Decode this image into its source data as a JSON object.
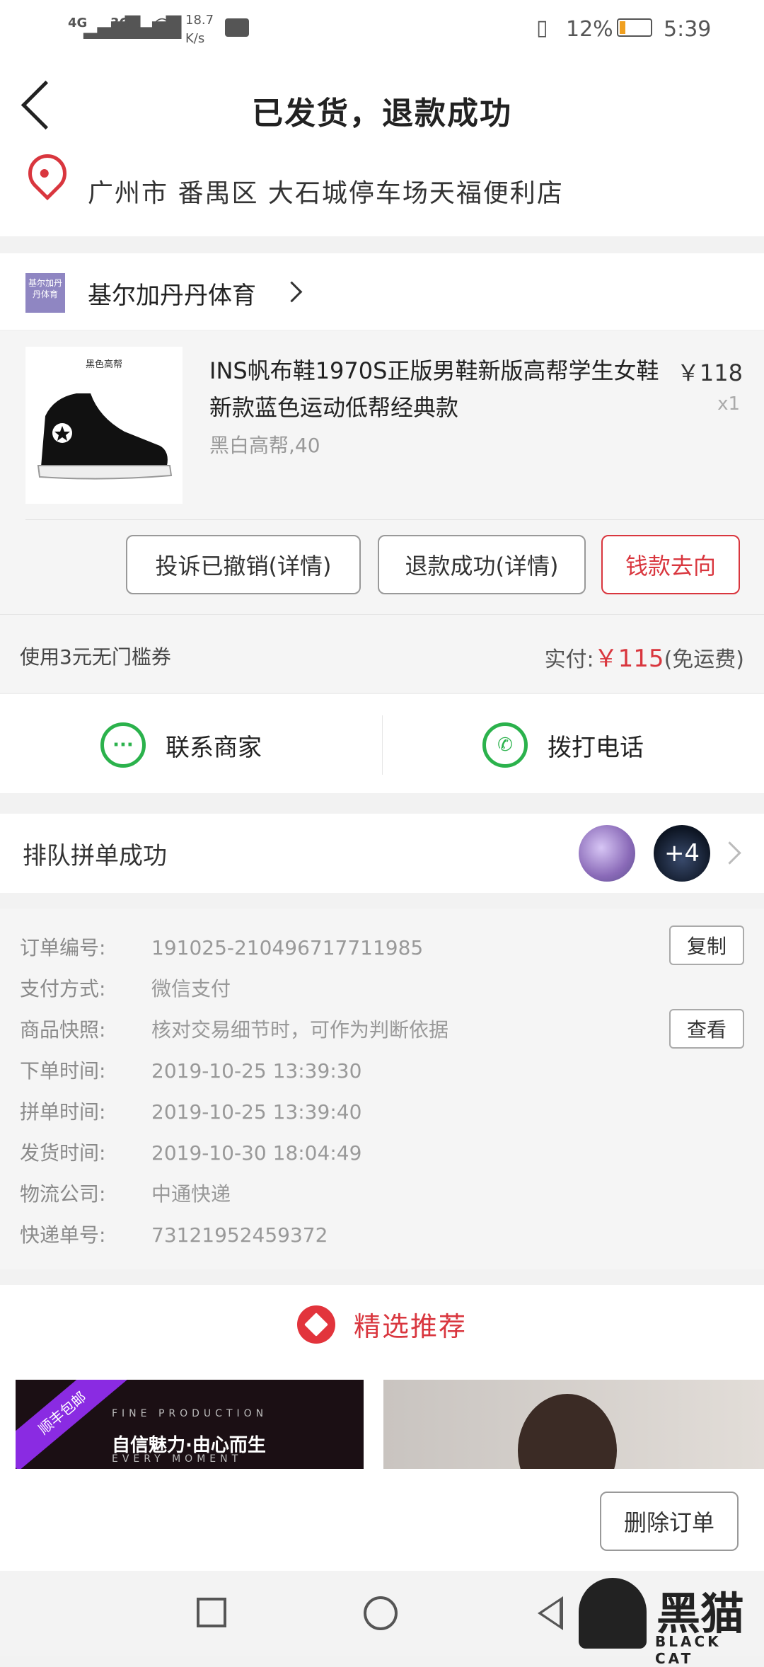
{
  "status_bar": {
    "signal1": "4G",
    "signal2": "3G",
    "speed": "18.7",
    "speed_unit": "K/s",
    "battery": "12%",
    "time": "5:39"
  },
  "header": {
    "title": "已发货，退款成功"
  },
  "address": {
    "text": "广州市  番禺区  大石城停车场天福便利店"
  },
  "shop": {
    "logo_text": "基尔加丹丹体育",
    "name": "基尔加丹丹体育"
  },
  "product": {
    "thumb_label": "黑色高帮",
    "name": "INS帆布鞋1970S正版男鞋新版高帮学生女鞋新款蓝色运动低帮经典款",
    "price": "￥118",
    "qty": "x1",
    "spec": "黑白高帮,40",
    "buttons": {
      "complaint": "投诉已撤销(详情)",
      "refund": "退款成功(详情)",
      "money_flow": "钱款去向"
    }
  },
  "summary": {
    "coupon": "使用3元无门槛券",
    "paid_label": "实付:",
    "paid_amount": "￥115",
    "shipping": "(免运费)"
  },
  "contact": {
    "seller": "联系商家",
    "phone": "拨打电话"
  },
  "group": {
    "text": "排队拼单成功",
    "more": "+4"
  },
  "details": {
    "rows": [
      {
        "label": "订单编号:",
        "value": "191025-210496717711985"
      },
      {
        "label": "支付方式:",
        "value": "微信支付"
      },
      {
        "label": "商品快照:",
        "value": "核对交易细节时，可作为判断依据"
      },
      {
        "label": "下单时间:",
        "value": "2019-10-25  13:39:30"
      },
      {
        "label": "拼单时间:",
        "value": "2019-10-25  13:39:40"
      },
      {
        "label": "发货时间:",
        "value": "2019-10-30  18:04:49"
      },
      {
        "label": "物流公司:",
        "value": "中通快递"
      },
      {
        "label": "快递单号:",
        "value": "73121952459372"
      }
    ],
    "copy_button": "复制",
    "view_button": "查看"
  },
  "recommend": {
    "title": "精选推荐",
    "tile1_ribbon": "顺丰包邮",
    "tile1_small": "FINE PRODUCTION",
    "tile1_big": "自信魅力·由心而生",
    "tile1_small2": "EVERY MOMENT"
  },
  "bottom": {
    "delete_order": "删除订单"
  },
  "watermark": {
    "big": "黑猫",
    "small": "BLACK CAT"
  },
  "colors": {
    "accent_red": "#d9363e",
    "green": "#2bb24c"
  }
}
